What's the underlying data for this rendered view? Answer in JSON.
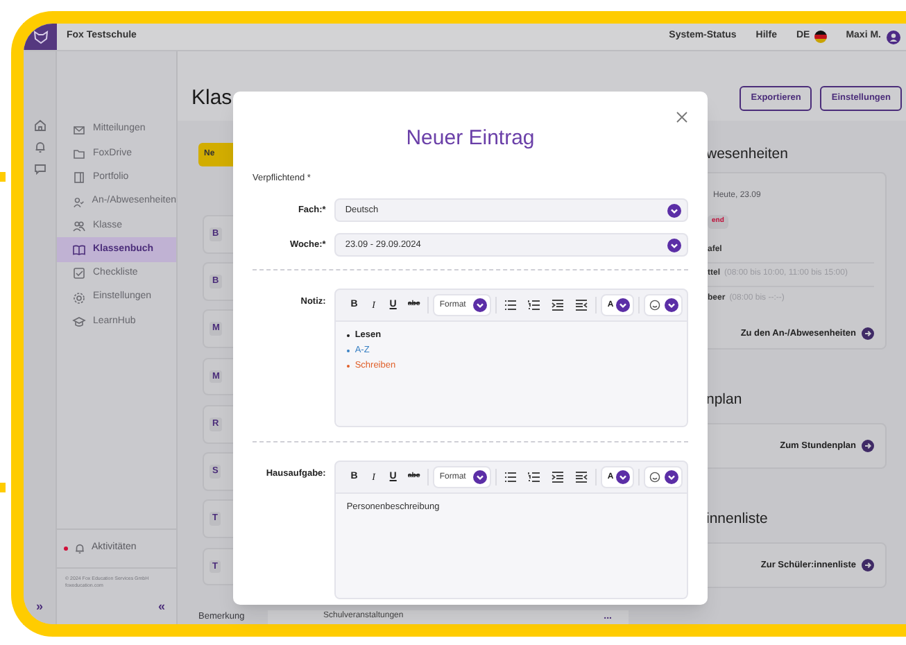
{
  "top_bar": {
    "school": "Fox Testschule",
    "links": [
      "System-Status",
      "Hilfe"
    ],
    "language": "DE",
    "user": "Maxi M."
  },
  "rail": {
    "expand": "»"
  },
  "sidebar": {
    "items": [
      {
        "label": "Mitteilungen",
        "selected": false
      },
      {
        "label": "FoxDrive",
        "selected": false
      },
      {
        "label": "Portfolio",
        "selected": false
      },
      {
        "label": "An-/Abwesenheiten",
        "selected": false
      },
      {
        "label": "Klasse",
        "selected": false
      },
      {
        "label": "Klassenbuch",
        "selected": true
      },
      {
        "label": "Checkliste",
        "selected": false
      },
      {
        "label": "Einstellungen",
        "selected": false
      },
      {
        "label": "LearnHub",
        "selected": false
      }
    ],
    "activity": {
      "label": "Aktivitäten",
      "unread": true
    },
    "footer": [
      "© 2024 Fox Education Services GmbH",
      "foxeducation.com"
    ],
    "collapse": "«"
  },
  "page": {
    "title": "Klas",
    "buttons": [
      "Exportieren",
      "Einstellungen"
    ],
    "new_button": "Ne",
    "entries": [
      "B",
      "B",
      "M",
      "M",
      "R",
      "S",
      "T",
      "T"
    ],
    "last_row": {
      "label": "Bemerkung",
      "value": "Schulveranstaltungen",
      "menu": "..."
    }
  },
  "attendance": {
    "heading": "wesenheiten",
    "date": "Heute, 23.09",
    "badge": "end",
    "rows": [
      {
        "name": "afel"
      },
      {
        "name": "ttel",
        "time": "(08:00 bis 10:00, 11:00 bis 15:00)"
      },
      {
        "name": "beer",
        "time": "(08:00 bis --:--)"
      }
    ],
    "link": "Zu den An-/Abwesenheiten"
  },
  "timetable": {
    "heading": "nplan",
    "link": "Zum Stundenplan"
  },
  "students": {
    "heading": "innenliste",
    "link": "Zur Schüler:innenliste"
  },
  "modal": {
    "title": "Neuer Eintrag",
    "required_note": "Verpflichtend *",
    "fields": [
      {
        "label": "Fach:*",
        "value": "Deutsch"
      },
      {
        "label": "Woche:*",
        "value": "23.09 - 29.09.2024"
      }
    ],
    "editors": [
      {
        "label": "Notiz:",
        "toolbar": {
          "bold": "B",
          "italic": "I",
          "underline": "U",
          "strike": "abc",
          "format": "Format",
          "text_color": "A"
        },
        "list": [
          {
            "text": "Lesen",
            "bold": true
          },
          {
            "text": "A-Z",
            "bold": false,
            "color": "#3b82c4"
          },
          {
            "text": "Schreiben",
            "bold": false,
            "color": "#e0602a"
          }
        ]
      },
      {
        "label": "Hausaufgabe:",
        "toolbar": {
          "bold": "B",
          "italic": "I",
          "underline": "U",
          "strike": "abc",
          "format": "Format",
          "text_color": "A"
        },
        "text": "Personenbeschreibung"
      }
    ]
  }
}
